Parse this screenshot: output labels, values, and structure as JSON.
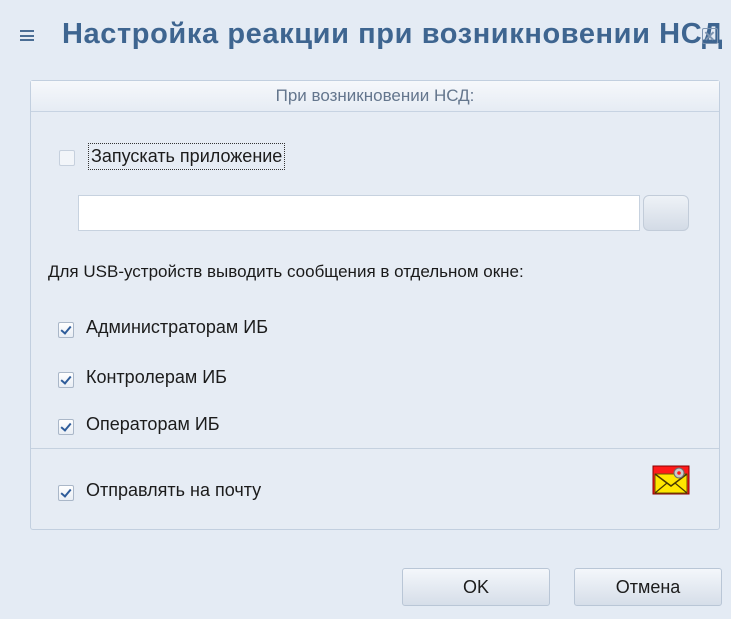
{
  "window": {
    "title": "Настройка реакции при возникновении НСД"
  },
  "panel": {
    "header": "При возникновении НСД:",
    "launch_app": {
      "label": "Запускать приложение",
      "checked": false
    },
    "app_path": {
      "value": ""
    },
    "usb_message_label": "Для USB-устройств выводить сообщения в отдельном окне:",
    "recipients": [
      {
        "label": "Администраторам ИБ",
        "checked": true
      },
      {
        "label": "Контролерам ИБ",
        "checked": true
      },
      {
        "label": "Операторам ИБ",
        "checked": true
      }
    ],
    "send_email": {
      "label": "Отправлять на почту",
      "checked": true
    }
  },
  "buttons": {
    "ok": "OK",
    "cancel": "Отмена"
  },
  "colors": {
    "background": "#e4ebf4",
    "title": "#3e6590",
    "accent": "#2e5c9a"
  }
}
